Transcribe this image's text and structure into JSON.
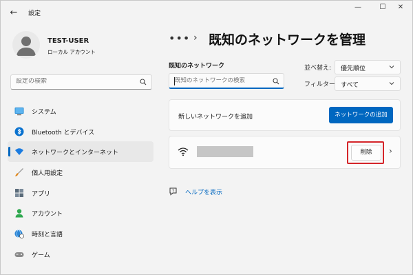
{
  "window": {
    "title": "設定",
    "back_glyph": "←",
    "minimize_glyph": "—",
    "maximize_glyph": "☐",
    "close_glyph": "✕"
  },
  "user": {
    "name": "TEST-USER",
    "account_type": "ローカル アカウント"
  },
  "search": {
    "placeholder": "設定の検索",
    "icon": "search-icon"
  },
  "sidebar": {
    "items": [
      {
        "label": "システム",
        "icon": "system-icon",
        "active": false
      },
      {
        "label": "Bluetooth とデバイス",
        "icon": "bluetooth-icon",
        "active": false
      },
      {
        "label": "ネットワークとインターネット",
        "icon": "wifi-icon",
        "active": true
      },
      {
        "label": "個人用設定",
        "icon": "brush-icon",
        "active": false
      },
      {
        "label": "アプリ",
        "icon": "apps-icon",
        "active": false
      },
      {
        "label": "アカウント",
        "icon": "account-icon",
        "active": false
      },
      {
        "label": "時刻と言語",
        "icon": "globe-clock-icon",
        "active": false
      },
      {
        "label": "ゲーム",
        "icon": "gamepad-icon",
        "active": false
      }
    ]
  },
  "main": {
    "breadcrumb_more": "•••",
    "breadcrumb_sep": "›",
    "page_title": "既知のネットワークを管理",
    "known_networks_label": "既知のネットワーク",
    "network_search_placeholder": "既知のネットワークの検索",
    "sort": {
      "label": "並べ替え:",
      "value": "優先順位"
    },
    "filter": {
      "label": "フィルター:",
      "value": "すべて"
    },
    "add_network": {
      "label": "新しいネットワークを追加",
      "button": "ネットワークの追加"
    },
    "network_row": {
      "delete_button": "削除",
      "chevron": "›"
    },
    "help_link": "ヘルプを表示"
  },
  "colors": {
    "accent": "#0067c0",
    "highlight_box": "#d4252a",
    "background": "#f3f3f3"
  }
}
